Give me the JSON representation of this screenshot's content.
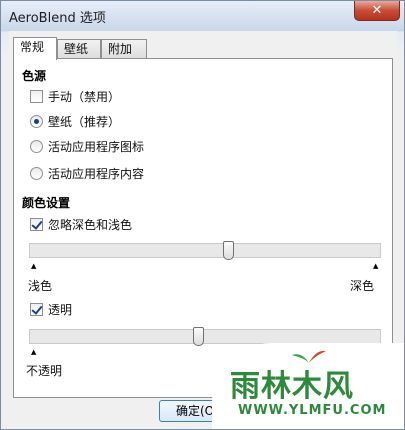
{
  "window": {
    "title": "AeroBlend 选项",
    "close_glyph": "✕"
  },
  "tabs": [
    {
      "label": "常规",
      "active": true
    },
    {
      "label": "壁纸",
      "active": false
    },
    {
      "label": "附加",
      "active": false
    }
  ],
  "color_source": {
    "label": "色源",
    "options": [
      {
        "label": "手动（禁用）",
        "type": "checkbox",
        "checked": false
      },
      {
        "label": "壁纸（推荐）",
        "type": "radio",
        "checked": true
      },
      {
        "label": "活动应用程序图标",
        "type": "radio",
        "checked": false
      },
      {
        "label": "活动应用程序内容",
        "type": "radio",
        "checked": false
      }
    ]
  },
  "color_settings": {
    "label": "颜色设置",
    "ignore_label": "忽略深色和浅色",
    "ignore_checked": true,
    "lightness_slider": {
      "value_fraction": 0.57,
      "min_label": "浅色",
      "max_label": "深色"
    },
    "transparent_label": "透明",
    "transparent_checked": true,
    "transparency_slider": {
      "value_fraction": 0.48,
      "min_label": "不透明"
    },
    "tick_glyph": "▲"
  },
  "buttons": {
    "ok_label": "确定(O)"
  },
  "watermark": {
    "brand": "雨林木风",
    "url": "WWW.YLMFU.COM"
  }
}
